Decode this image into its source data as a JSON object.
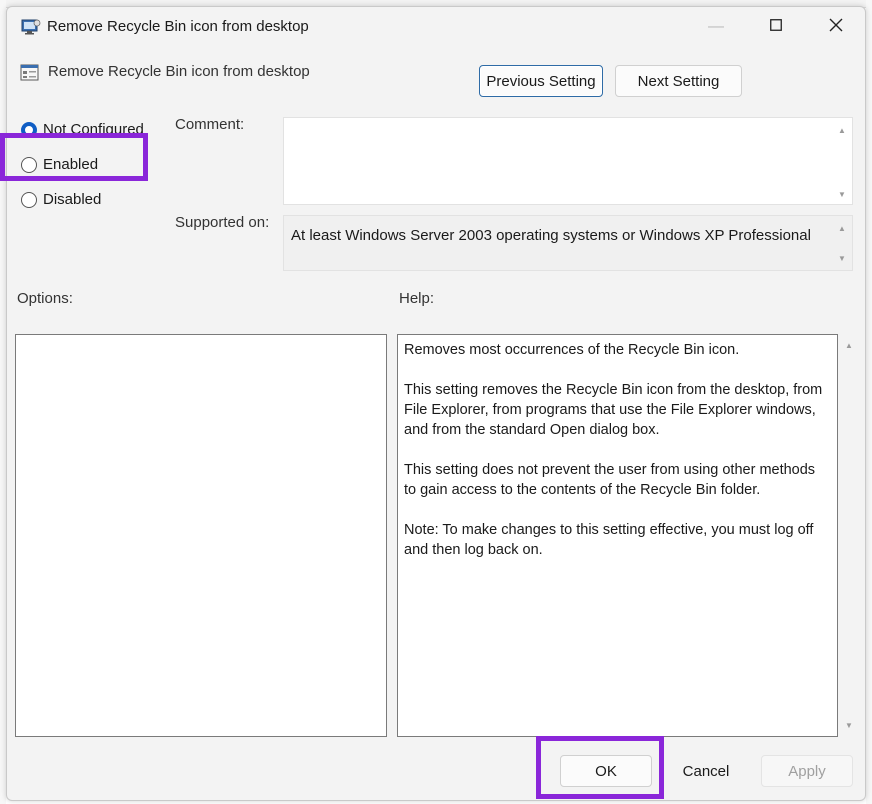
{
  "window": {
    "title": "Remove Recycle Bin icon from desktop",
    "minimize_glyph": "—",
    "maximize_glyph": "☐",
    "close_glyph": "✕"
  },
  "header": {
    "setting_name": "Remove Recycle Bin icon from desktop",
    "previous_label": "Previous Setting",
    "next_label": "Next Setting"
  },
  "state": {
    "options": [
      {
        "label": "Not Configured",
        "checked": true
      },
      {
        "label": "Enabled",
        "checked": false
      },
      {
        "label": "Disabled",
        "checked": false
      }
    ]
  },
  "fields": {
    "comment_label": "Comment:",
    "comment_value": "",
    "supported_label": "Supported on:",
    "supported_value": "At least Windows Server 2003 operating systems or Windows XP Professional"
  },
  "panes": {
    "options_label": "Options:",
    "help_label": "Help:",
    "help_paragraphs": [
      "Removes most occurrences of the Recycle Bin icon.",
      "This setting removes the Recycle Bin icon from the desktop, from File Explorer, from programs that use the File Explorer windows, and from the standard Open dialog box.",
      "This setting does not prevent the user from using other methods to gain access to the contents of the Recycle Bin folder.",
      "Note: To make changes to this setting effective, you must log off and then log back on."
    ]
  },
  "footer": {
    "ok_label": "OK",
    "cancel_label": "Cancel",
    "apply_label": "Apply"
  },
  "colors": {
    "highlight": "#8a26d9",
    "radio_checked": "#0f5dc4",
    "dialog_bg": "#f3f3f3"
  },
  "icons": {
    "app": "policy-window-icon",
    "header": "policy-setting-icon",
    "scroll_up": "▲",
    "scroll_down": "▼"
  }
}
